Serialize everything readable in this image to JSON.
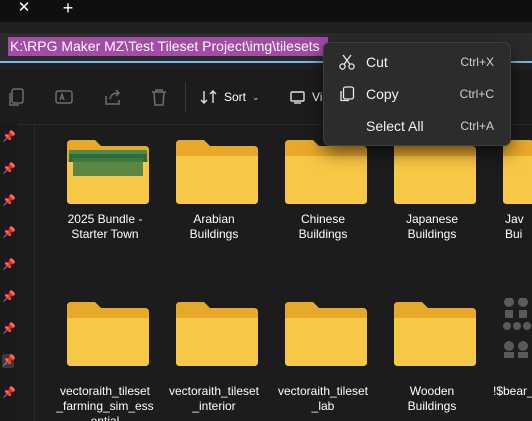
{
  "tabbar": {
    "close_glyph": "✕",
    "new_glyph": "+"
  },
  "address": {
    "path": "K:\\RPG Maker MZ\\Test Tileset Project\\img\\tilesets"
  },
  "toolbar": {
    "sort_label": "Sort",
    "view_label": "View",
    "icons": [
      "copy-icon",
      "rename-icon",
      "share-icon",
      "delete-icon"
    ]
  },
  "context_menu": {
    "items": [
      {
        "label": "Cut",
        "shortcut": "Ctrl+X",
        "icon": "scissors-icon"
      },
      {
        "label": "Copy",
        "shortcut": "Ctrl+C",
        "icon": "copy-icon"
      },
      {
        "label": "Select All",
        "shortcut": "Ctrl+A",
        "icon": ""
      }
    ]
  },
  "folders": [
    {
      "name": "2025 Bundle - Starter Town",
      "line1": "2025 Bundle -",
      "line2": "Starter Town",
      "has_preview": true
    },
    {
      "name": "Arabian Buildings",
      "line1": "Arabian",
      "line2": "Buildings"
    },
    {
      "name": "Chinese Buildings",
      "line1": "Chinese",
      "line2": "Buildings"
    },
    {
      "name": "Japanese Buildings",
      "line1": "Japanese",
      "line2": "Buildings"
    },
    {
      "name": "Javanese Buildings",
      "line1": "Jav",
      "line2": "Bui"
    },
    {
      "name": "vectoraith_tileset_farming_sim_essentials",
      "line1": "vectoraith_tileset",
      "line2": "_farming_sim_ess",
      "line3": "ential"
    },
    {
      "name": "vectoraith_tileset_interior",
      "line1": "vectoraith_tileset",
      "line2": "_interior"
    },
    {
      "name": "vectoraith_tileset_lab",
      "line1": "vectoraith_tileset",
      "line2": "_lab"
    },
    {
      "name": "Wooden Buildings",
      "line1": "Wooden",
      "line2": "Buildings"
    },
    {
      "name": "!$bear_",
      "line1": "!$bear_",
      "line2": ""
    }
  ],
  "colors": {
    "accent": "#76b9ed",
    "selection": "#a44ba8",
    "folder_front": "#f7c845",
    "folder_back": "#e8a92a"
  }
}
